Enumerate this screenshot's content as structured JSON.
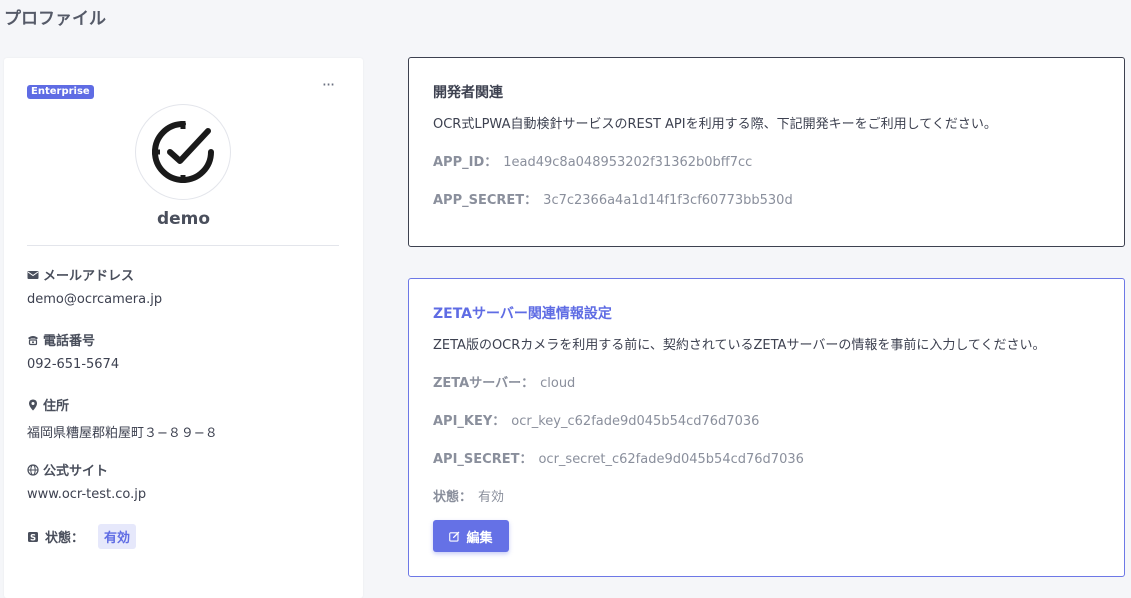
{
  "page": {
    "title": "プロファイル"
  },
  "profile": {
    "badge": "Enterprise",
    "more_label": "···",
    "avatar_icon": "clock-check-icon",
    "username": "demo",
    "email_label": "メールアドレス",
    "email": "demo@ocrcamera.jp",
    "phone_label": "電話番号",
    "phone": "092-651-5674",
    "address_label": "住所",
    "address": "福岡県糟屋郡粕屋町３−８９−８",
    "website_label": "公式サイト",
    "website": "www.ocr-test.co.jp",
    "status_label": "状態：",
    "status_value": "有効"
  },
  "developer": {
    "title": "開発者関連",
    "description": "OCR式LPWA自動検針サービスのREST APIを利用する際、下記開発キーをご利用してください。",
    "app_id_label": "APP_ID：",
    "app_id": "1ead49c8a048953202f31362b0bff7cc",
    "app_secret_label": "APP_SECRET：",
    "app_secret": "3c7c2366a4a1d14f1f3cf60773bb530d"
  },
  "zeta": {
    "title": "ZETAサーバー関連情報設定",
    "description": "ZETA版のOCRカメラを利用する前に、契約されているZETAサーバーの情報を事前に入力してください。",
    "server_label": "ZETAサーバー：",
    "server": "cloud",
    "api_key_label": "API_KEY：",
    "api_key": "ocr_key_c62fade9d045b54cd76d7036",
    "api_secret_label": "API_SECRET：",
    "api_secret": "ocr_secret_c62fade9d045b54cd76d7036",
    "status_label": "状態：",
    "status": "有効",
    "edit_label": "編集"
  },
  "colors": {
    "accent": "#5f6ce4",
    "background": "#f5f6f9",
    "muted_text": "#8a8f9c"
  }
}
